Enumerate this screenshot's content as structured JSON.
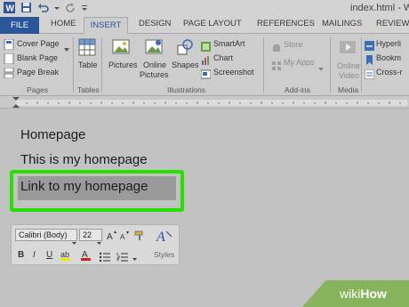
{
  "window": {
    "title": "index.html - Word"
  },
  "tabs": [
    "FILE",
    "HOME",
    "INSERT",
    "DESIGN",
    "PAGE LAYOUT",
    "REFERENCES",
    "MAILINGS",
    "REVIEW"
  ],
  "active_tab": "INSERT",
  "ribbon": {
    "pages": {
      "cover_page": "Cover Page",
      "blank_page": "Blank Page",
      "page_break": "Page Break",
      "label": "Pages"
    },
    "tables": {
      "table": "Table",
      "label": "Tables"
    },
    "illustrations": {
      "pictures": "Pictures",
      "online": "Online",
      "pictures2": "Pictures",
      "shapes": "Shapes",
      "smartart": "SmartArt",
      "chart": "Chart",
      "screenshot": "Screenshot",
      "label": "Illustrations"
    },
    "addins": {
      "store": "Store",
      "my_apps": "My Apps",
      "label": "Add-ins"
    },
    "media": {
      "online": "Online",
      "video": "Video",
      "label": "Media"
    },
    "links": {
      "hyperlink": "Hyperli",
      "bookmark": "Bookm",
      "cross_ref": "Cross-r"
    }
  },
  "document": {
    "line1": "Homepage",
    "line2": "This is my homepage",
    "line3": "Link to my homepage"
  },
  "mini_toolbar": {
    "font": "Calibri (Body)",
    "size": "22",
    "bold": "B",
    "italic": "I",
    "underline": "U",
    "styles": "Styles"
  },
  "watermark": {
    "wiki": "wiki",
    "how": "How"
  },
  "colors": {
    "file_tab": "#2b579a",
    "highlight": "#26e000",
    "watermark": "#88b35d"
  }
}
